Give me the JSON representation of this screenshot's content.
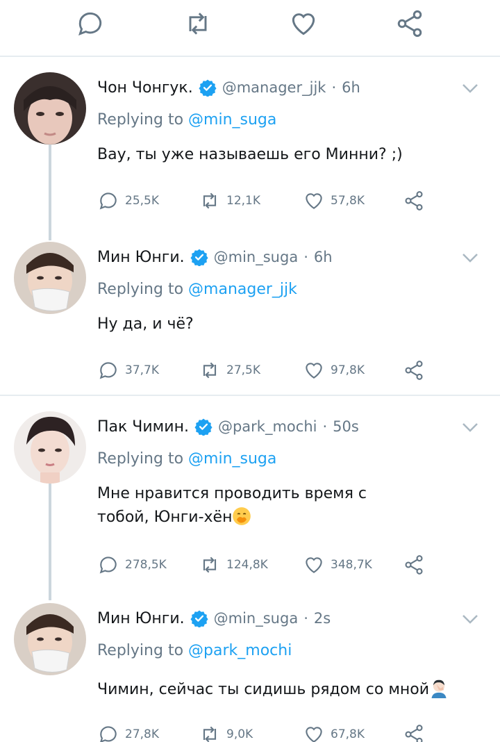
{
  "tweets": [
    {
      "name": "Чон Чонгук.",
      "handle": "@manager_jjk",
      "time": "6h",
      "replying_label": "Replying to",
      "replying_to": "@min_suga",
      "text": "Вау, ты уже называешь его Минни? ;)",
      "emoji": "",
      "replies": "25,5K",
      "retweets": "12,1K",
      "likes": "57,8K"
    },
    {
      "name": "Мин Юнги.",
      "handle": "@min_suga",
      "time": "6h",
      "replying_label": "Replying to",
      "replying_to": "@manager_jjk",
      "text": "Ну да, и чё?",
      "emoji": "",
      "replies": "37,7K",
      "retweets": "27,5K",
      "likes": "97,8K"
    },
    {
      "name": "Пак Чимин.",
      "handle": "@park_mochi",
      "time": "50s",
      "replying_label": "Replying to",
      "replying_to": "@min_suga",
      "text": "Мне нравится проводить время с тобой, Юнги-хён",
      "emoji": "hand-over-mouth-emoji",
      "replies": "278,5K",
      "retweets": "124,8K",
      "likes": "348,7K"
    },
    {
      "name": "Мин Юнги.",
      "handle": "@min_suga",
      "time": "2s",
      "replying_label": "Replying to",
      "replying_to": "@park_mochi",
      "text": "Чимин, сейчас ты сидишь рядом со мной",
      "emoji": "facepalm-emoji",
      "replies": "27,8K",
      "retweets": "9,0K",
      "likes": "67,8K"
    }
  ],
  "dot": "·",
  "colors": {
    "accent": "#1da1f2",
    "secondary_text": "#657786",
    "primary_text": "#14171a",
    "divider": "#e6ecf0",
    "thread_line": "#ccd6dd"
  }
}
